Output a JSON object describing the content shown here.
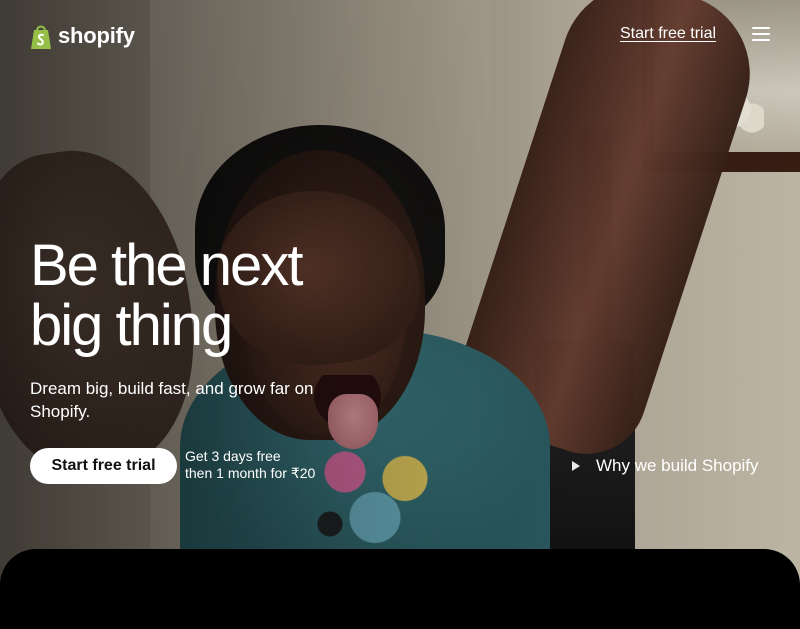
{
  "brand": {
    "name": "shopify",
    "accent_green": "#95bf47",
    "logo_icon": "shopping-bag-icon"
  },
  "nav": {
    "cta_label": "Start free trial",
    "menu_icon": "hamburger-menu-icon"
  },
  "hero": {
    "title_line1": "Be the next",
    "title_line2": "big thing",
    "subtitle": "Dream big, build fast, and grow far on Shopify.",
    "primary_cta": "Start free trial",
    "offer_line1": "Get 3 days free",
    "offer_line2": "then 1 month for ₹20",
    "video_link": "Why we build Shopify",
    "video_icon": "play-icon"
  },
  "colors": {
    "text": "#ffffff",
    "button_bg": "#ffffff",
    "button_text": "#111111",
    "panel_bg": "#000000"
  }
}
